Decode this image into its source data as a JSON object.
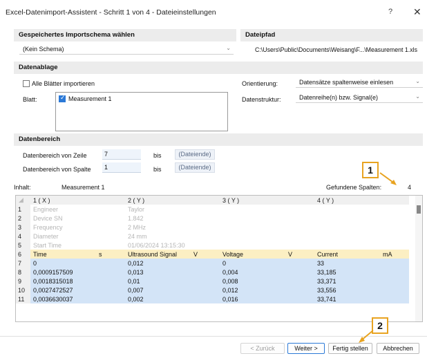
{
  "window": {
    "title": "Excel-Datenimport-Assistent - Schritt 1 von 4 - Dateieinstellungen",
    "help": "?",
    "close": "✕"
  },
  "schema": {
    "heading": "Gespeichertes Importschema wählen",
    "selected": "(Kein Schema)"
  },
  "file": {
    "heading": "Dateipfad",
    "path": "C:\\Users\\Public\\Documents\\Weisang\\F...\\Measurement 1.xls"
  },
  "storage": {
    "heading": "Datenablage",
    "all_sheets_label": "Alle Blätter importieren",
    "sheet_label": "Blatt:",
    "sheets": [
      "Measurement 1"
    ],
    "orientation_label": "Orientierung:",
    "orientation_value": "Datensätze spaltenweise einlesen",
    "structure_label": "Datenstruktur:",
    "structure_value": "Datenreihe(n) bzw. Signal(e)"
  },
  "range": {
    "heading": "Datenbereich",
    "row_label": "Datenbereich von Zeile",
    "row_value": "7",
    "col_label": "Datenbereich von Spalte",
    "col_value": "1",
    "bis": "bis",
    "end": "(Dateiende)"
  },
  "content": {
    "label": "Inhalt:",
    "sheet_name": "Measurement 1",
    "found_label": "Gefundene Spalten:",
    "found_value": "4"
  },
  "grid": {
    "columns": [
      "1 ( X )",
      "",
      "2 ( Y )",
      "",
      "3 ( Y )",
      "",
      "4 ( Y )",
      ""
    ],
    "rows": [
      {
        "n": "1",
        "type": "meta",
        "cells": [
          "Engineer",
          "",
          "Taylor",
          "",
          "",
          "",
          "",
          ""
        ]
      },
      {
        "n": "2",
        "type": "meta",
        "cells": [
          "Device SN",
          "",
          "1.842",
          "",
          "",
          "",
          "",
          ""
        ]
      },
      {
        "n": "3",
        "type": "meta",
        "cells": [
          "Frequency",
          "",
          "2 MHz",
          "",
          "",
          "",
          "",
          ""
        ]
      },
      {
        "n": "4",
        "type": "meta",
        "cells": [
          "Diameter",
          "",
          "24 mm",
          "",
          "",
          "",
          "",
          ""
        ]
      },
      {
        "n": "5",
        "type": "meta",
        "cells": [
          "Start Time",
          "",
          "01/06/2024 13:15:30",
          "",
          "",
          "",
          "",
          ""
        ]
      },
      {
        "n": "6",
        "type": "names",
        "cells": [
          "Time",
          "s",
          "Ultrasound Signal",
          "V",
          "Voltage",
          "V",
          "Current",
          "mA"
        ]
      },
      {
        "n": "7",
        "type": "data",
        "cells": [
          "0",
          "",
          "0,012",
          "",
          "0",
          "",
          "33",
          ""
        ]
      },
      {
        "n": "8",
        "type": "data",
        "cells": [
          "0,0009157509",
          "",
          "0,013",
          "",
          "0,004",
          "",
          "33,185",
          ""
        ]
      },
      {
        "n": "9",
        "type": "data",
        "cells": [
          "0,0018315018",
          "",
          "0,01",
          "",
          "0,008",
          "",
          "33,371",
          ""
        ]
      },
      {
        "n": "10",
        "type": "data",
        "cells": [
          "0,0027472527",
          "",
          "0,007",
          "",
          "0,012",
          "",
          "33,556",
          ""
        ]
      },
      {
        "n": "11",
        "type": "data",
        "cells": [
          "0,0036630037",
          "",
          "0,002",
          "",
          "0,016",
          "",
          "33,741",
          ""
        ]
      }
    ]
  },
  "buttons": {
    "back": "< Zurück",
    "next": "Weiter >",
    "finish": "Fertig stellen",
    "cancel": "Abbrechen"
  },
  "callouts": {
    "one": "1",
    "two": "2",
    "color": "#e8a320"
  }
}
